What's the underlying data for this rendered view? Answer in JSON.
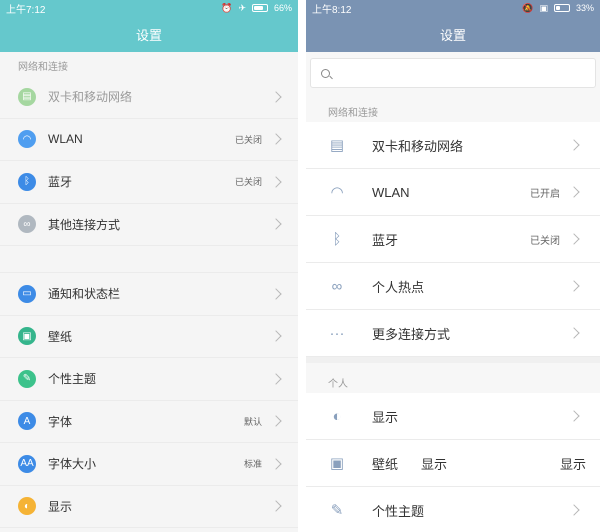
{
  "left": {
    "status": {
      "time": "上午7:12",
      "battery": "66%",
      "battery_level": 0.66
    },
    "title": "设置",
    "section_network": "网络和连接",
    "network_items": [
      {
        "label": "双卡和移动网络",
        "value": "",
        "icon": "dual-sim-icon",
        "color": "#a5d7a0",
        "dim": true
      },
      {
        "label": "WLAN",
        "value": "已关闭",
        "icon": "wifi-icon",
        "color": "#4f9ef0"
      },
      {
        "label": "蓝牙",
        "value": "已关闭",
        "icon": "bluetooth-icon",
        "color": "#3d8be6"
      },
      {
        "label": "其他连接方式",
        "value": "",
        "icon": "link-icon",
        "color": "#b0b8c0"
      }
    ],
    "personal_items": [
      {
        "label": "通知和状态栏",
        "value": "",
        "icon": "notification-icon",
        "color": "#3d8be6"
      },
      {
        "label": "壁纸",
        "value": "",
        "icon": "wallpaper-icon",
        "color": "#35b58c"
      },
      {
        "label": "个性主题",
        "value": "",
        "icon": "theme-icon",
        "color": "#3cc28b"
      },
      {
        "label": "字体",
        "value": "默认",
        "icon": "font-icon",
        "color": "#3d8be6",
        "glyph": "A"
      },
      {
        "label": "字体大小",
        "value": "标准",
        "icon": "font-size-icon",
        "color": "#3d8be6",
        "glyph": "AA"
      },
      {
        "label": "显示",
        "value": "",
        "icon": "display-icon",
        "color": "#f5b335"
      }
    ]
  },
  "right": {
    "status": {
      "time": "上午8:12",
      "battery": "33%",
      "battery_level": 0.33
    },
    "title": "设置",
    "search_placeholder": "",
    "section_network": "网络和连接",
    "network_items": [
      {
        "label": "双卡和移动网络",
        "value": "",
        "icon": "dual-sim-icon"
      },
      {
        "label": "WLAN",
        "value": "已开启",
        "icon": "wifi-icon"
      },
      {
        "label": "蓝牙",
        "value": "已关闭",
        "icon": "bluetooth-icon"
      },
      {
        "label": "个人热点",
        "value": "",
        "icon": "hotspot-icon"
      },
      {
        "label": "更多连接方式",
        "value": "",
        "icon": "more-icon"
      }
    ],
    "section_personal": "个人",
    "personal_items": [
      {
        "label": "显示",
        "value": "",
        "icon": "display-icon"
      },
      {
        "label": "壁纸",
        "value": "",
        "icon": "wallpaper-icon",
        "overlay_mid": "显示",
        "overlay_right": "显示"
      },
      {
        "label": "个性主题",
        "value": "",
        "icon": "theme-icon"
      }
    ]
  }
}
